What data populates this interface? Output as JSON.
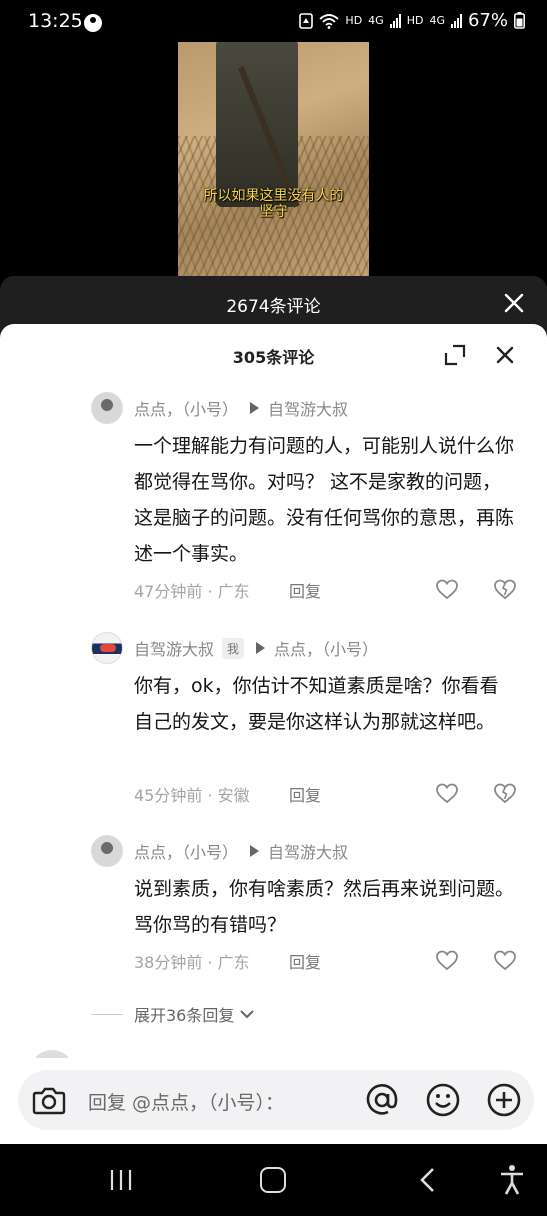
{
  "status_bar": {
    "time": "13:25",
    "indicators": [
      "HD",
      "4G",
      "HD",
      "4G"
    ],
    "battery": "67%"
  },
  "video": {
    "caption_line1": "所以如果这里没有人的",
    "caption_line2": "坚守"
  },
  "outer_sheet": {
    "title": "2674条评论"
  },
  "reply_sheet": {
    "title": "305条评论",
    "comments": [
      {
        "author": "点点，（小号）",
        "reply_to": "自驾游大叔",
        "text": "一个理解能力有问题的人，可能别人说什么你都觉得在骂你。对吗？ 这不是家教的问题，这是脑子的问题。没有任何骂你的意思，再陈述一个事实。",
        "time_location": "47分钟前 · 广东",
        "reply_label": "回复"
      },
      {
        "author": "自驾游大叔",
        "badge": "我",
        "reply_to": "点点，（小号）",
        "text": "你有，ok，你估计不知道素质是啥？你看看自己的发文，要是你这样认为那就这样吧。",
        "time_location": "45分钟前 · 安徽",
        "reply_label": "回复"
      },
      {
        "author": "点点，（小号）",
        "reply_to": "自驾游大叔",
        "text": "说到素质，你有啥素质？然后再来说到问题。骂你骂的有错吗？",
        "time_location": "38分钟前 · 广东",
        "reply_label": "回复"
      }
    ],
    "expand_label": "展开36条回复"
  },
  "input_bar": {
    "placeholder": "回复 @点点，（小号）："
  },
  "colors": {
    "caption": "#f2d34a",
    "outer_header_bg": "#1f1f1f",
    "sheet_bg": "#ffffff",
    "input_bg": "#f2f2f4"
  }
}
